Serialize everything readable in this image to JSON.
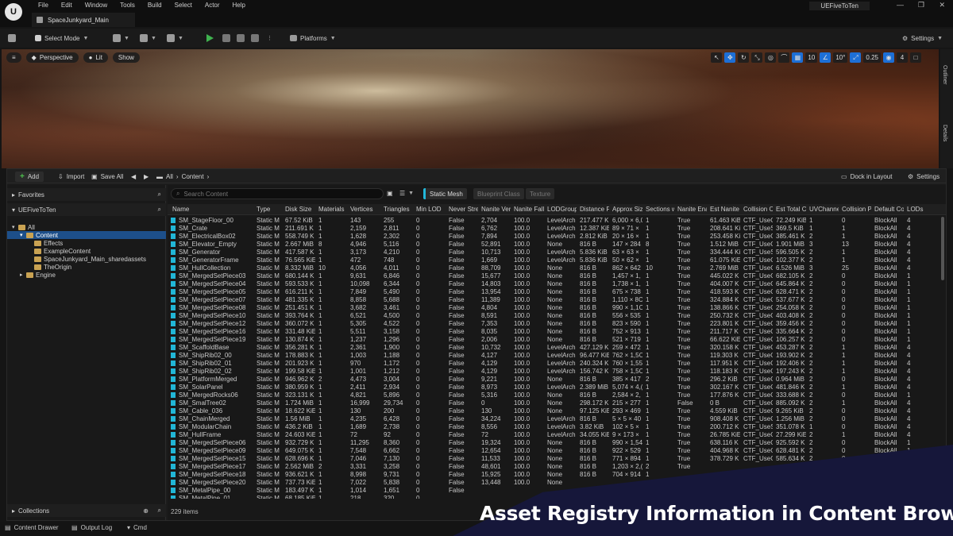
{
  "menu": [
    "File",
    "Edit",
    "Window",
    "Tools",
    "Build",
    "Select",
    "Actor",
    "Help"
  ],
  "project_name": "UEFiveToTen",
  "level_tab": "SpaceJunkyard_Main",
  "toolbar": {
    "select_mode": "Select Mode",
    "platforms": "Platforms",
    "settings": "Settings"
  },
  "viewport": {
    "perspective": "Perspective",
    "lit": "Lit",
    "show": "Show",
    "grid_snap": "10",
    "rot_snap": "10°",
    "scale_snap": "0.25",
    "camera_speed": "4",
    "side_tabs": [
      "Outliner",
      "Details"
    ]
  },
  "content_browser": {
    "add": "Add",
    "import": "Import",
    "save_all": "Save All",
    "path": [
      "All",
      "Content"
    ],
    "dock": "Dock in Layout",
    "settings": "Settings",
    "favorites": "Favorites",
    "project": "UEFiveToTen",
    "collections": "Collections",
    "tree": [
      {
        "label": "All",
        "level": 0
      },
      {
        "label": "Content",
        "level": 1,
        "selected": true
      },
      {
        "label": "Effects",
        "level": 2
      },
      {
        "label": "ExampleContent",
        "level": 2
      },
      {
        "label": "SpaceJunkyard_Main_sharedassets",
        "level": 2
      },
      {
        "label": "TheOrigin",
        "level": 2
      },
      {
        "label": "Engine",
        "level": 1
      }
    ],
    "search_placeholder": "Search Content",
    "filters": [
      {
        "label": "Static Mesh",
        "active": true
      },
      {
        "label": "Blueprint Class",
        "active": false
      },
      {
        "label": "Texture",
        "active": false
      }
    ],
    "columns": [
      "Name",
      "Type",
      "Disk Size",
      "Materials",
      "Vertices",
      "Triangles",
      "Min LOD",
      "Never Stre",
      "Nanite Ver",
      "Nanite Fall",
      "LODGroup",
      "Distance F",
      "Approx Siz",
      "Sections w",
      "Nanite Ena",
      "Est Nanite",
      "Collision Co",
      "Est Total C",
      "UVChanne",
      "Collision Pr",
      "Default Col",
      "LODs"
    ],
    "rows": [
      [
        "SM_StageFloor_00",
        "Static M",
        "67.52 KiB",
        "1",
        "143",
        "255",
        "0",
        "False",
        "2,704",
        "100.0",
        "LevelArch",
        "217.477 K",
        "6,000 × 6,0",
        "1",
        "True",
        "61.463 KiB",
        "CTF_UseC",
        "72.249 KiB",
        "1",
        "0",
        "BlockAll",
        "4"
      ],
      [
        "SM_Crate",
        "Static M",
        "211.691 K",
        "1",
        "2,159",
        "2,811",
        "0",
        "False",
        "6,762",
        "100.0",
        "LevelArch",
        "12.387 KiB",
        "89 × 71 ×",
        "1",
        "True",
        "208.641 Ki",
        "CTF_UseS",
        "369.5 KiB",
        "1",
        "1",
        "BlockAll",
        "4"
      ],
      [
        "SM_ElectricalBox02",
        "Static M",
        "558.749 K",
        "1",
        "1,628",
        "2,302",
        "0",
        "False",
        "7,894",
        "100.0",
        "LevelArch",
        "2.812 KiB",
        "20 × 16 ×",
        "1",
        "True",
        "253.458 Ki",
        "CTF_UseC",
        "385.461 K",
        "2",
        "1",
        "BlockAll",
        "4"
      ],
      [
        "SM_Elevator_Empty",
        "Static M",
        "2.667 MiB",
        "8",
        "4,946",
        "5,116",
        "0",
        "False",
        "52,891",
        "100.0",
        "None",
        "816 B",
        "147 × 284",
        "8",
        "True",
        "1.512 MiB",
        "CTF_UseC",
        "1.901 MiB",
        "3",
        "13",
        "BlockAll",
        "4"
      ],
      [
        "SM_Generator",
        "Static M",
        "417.587 K",
        "1",
        "3,173",
        "4,210",
        "0",
        "False",
        "10,713",
        "100.0",
        "LevelArch",
        "5.836 KiB",
        "63 × 63 ×",
        "1",
        "True",
        "334.444 Ki",
        "CTF_UseS",
        "596.505 K",
        "2",
        "1",
        "BlockAll",
        "4"
      ],
      [
        "SM_GeneratorFrame",
        "Static M",
        "76.565 KiE",
        "1",
        "472",
        "748",
        "0",
        "False",
        "1,669",
        "100.0",
        "LevelArch",
        "5.836 KiB",
        "50 × 62 ×",
        "1",
        "True",
        "61.075 KiE",
        "CTF_UseC",
        "102.377 K",
        "2",
        "1",
        "BlockAll",
        "4"
      ],
      [
        "SM_HullCollection",
        "Static M",
        "8.332 MiB",
        "10",
        "4,056",
        "4,011",
        "0",
        "False",
        "88,709",
        "100.0",
        "None",
        "816 B",
        "862 × 642",
        "10",
        "True",
        "2.769 MiB",
        "CTF_UseC",
        "6.526 MiB",
        "3",
        "25",
        "BlockAll",
        "4"
      ],
      [
        "SM_MergedSetPiece03",
        "Static M",
        "680.144 K",
        "1",
        "9,631",
        "6,846",
        "0",
        "False",
        "15,677",
        "100.0",
        "None",
        "816 B",
        "1,457 × 1,",
        "1",
        "True",
        "445.022 K",
        "CTF_UseC",
        "682.105 K",
        "2",
        "0",
        "BlockAll",
        "1"
      ],
      [
        "SM_MergedSetPiece04",
        "Static M",
        "593.533 K",
        "1",
        "10,098",
        "6,344",
        "0",
        "False",
        "14,803",
        "100.0",
        "None",
        "816 B",
        "1,738 × 1,",
        "1",
        "True",
        "404.007 K",
        "CTF_UseC",
        "645.864 K",
        "2",
        "0",
        "BlockAll",
        "1"
      ],
      [
        "SM_MergedSetPiece05",
        "Static M",
        "616.211 K",
        "1",
        "7,849",
        "5,490",
        "0",
        "False",
        "13,954",
        "100.0",
        "None",
        "816 B",
        "675 × 738",
        "1",
        "True",
        "418.593 K",
        "CTF_UseC",
        "628.471 K",
        "2",
        "0",
        "BlockAll",
        "1"
      ],
      [
        "SM_MergedSetPiece07",
        "Static M",
        "481.335 K",
        "1",
        "8,858",
        "5,688",
        "0",
        "False",
        "11,389",
        "100.0",
        "None",
        "816 B",
        "1,110 × 8C",
        "1",
        "True",
        "324.884 K",
        "CTF_UseC",
        "537.677 K",
        "2",
        "0",
        "BlockAll",
        "1"
      ],
      [
        "SM_MergedSetPiece08",
        "Static M",
        "251.451 K",
        "1",
        "3,682",
        "3,461",
        "0",
        "False",
        "4,804",
        "100.0",
        "None",
        "816 B",
        "990 × 1,1C",
        "1",
        "True",
        "138.866 K",
        "CTF_UseC",
        "254.058 K",
        "2",
        "0",
        "BlockAll",
        "1"
      ],
      [
        "SM_MergedSetPiece10",
        "Static M",
        "393.764 K",
        "1",
        "6,521",
        "4,500",
        "0",
        "False",
        "8,591",
        "100.0",
        "None",
        "816 B",
        "556 × 535",
        "1",
        "True",
        "250.732 K",
        "CTF_UseC",
        "403.408 K",
        "2",
        "0",
        "BlockAll",
        "1"
      ],
      [
        "SM_MergedSetPiece12",
        "Static M",
        "360.072 K",
        "1",
        "5,305",
        "4,522",
        "0",
        "False",
        "7,353",
        "100.0",
        "None",
        "816 B",
        "823 × 590",
        "1",
        "True",
        "223.801 K",
        "CTF_UseC",
        "359.456 K",
        "2",
        "0",
        "BlockAll",
        "1"
      ],
      [
        "SM_MergedSetPiece16",
        "Static M",
        "331.48 KiE",
        "1",
        "5,511",
        "3,158",
        "0",
        "False",
        "8,035",
        "100.0",
        "None",
        "816 B",
        "752 × 913",
        "1",
        "True",
        "211.717 K",
        "CTF_UseC",
        "335.664 K",
        "2",
        "0",
        "BlockAll",
        "1"
      ],
      [
        "SM_MergedSetPiece19",
        "Static M",
        "130.874 K",
        "1",
        "1,237",
        "1,296",
        "0",
        "False",
        "2,006",
        "100.0",
        "None",
        "816 B",
        "521 × 719",
        "1",
        "True",
        "66.622 KiE",
        "CTF_UseC",
        "106.257 K",
        "2",
        "0",
        "BlockAll",
        "1"
      ],
      [
        "SM_ScaffoldBase",
        "Static M",
        "356.281 K",
        "1",
        "2,361",
        "1,900",
        "0",
        "False",
        "10,732",
        "100.0",
        "LevelArch",
        "427.129 K",
        "259 × 472",
        "1",
        "True",
        "320.158 K",
        "CTF_UseC",
        "453.287 K",
        "2",
        "1",
        "BlockAll",
        "4"
      ],
      [
        "SM_ShipRib02_00",
        "Static M",
        "178.883 K",
        "1",
        "1,003",
        "1,188",
        "0",
        "False",
        "4,127",
        "100.0",
        "LevelArch",
        "96.477 KiE",
        "762 × 1,5C",
        "1",
        "True",
        "119.303 K",
        "CTF_UseC",
        "193.902 K",
        "2",
        "1",
        "BlockAll",
        "4"
      ],
      [
        "SM_ShipRib02_01",
        "Static M",
        "201.923 K",
        "1",
        "970",
        "1,172",
        "0",
        "False",
        "4,129",
        "100.0",
        "LevelArch",
        "240.324 K",
        "760 × 1,55",
        "1",
        "True",
        "117.951 K",
        "CTF_UseC",
        "192.406 K",
        "2",
        "1",
        "BlockAll",
        "4"
      ],
      [
        "SM_ShipRib02_02",
        "Static M",
        "199.58 KiE",
        "1",
        "1,001",
        "1,212",
        "0",
        "False",
        "4,129",
        "100.0",
        "LevelArch",
        "156.742 K",
        "758 × 1,5C",
        "1",
        "True",
        "118.183 K",
        "CTF_UseC",
        "197.243 K",
        "2",
        "1",
        "BlockAll",
        "4"
      ],
      [
        "SM_PlatformMerged",
        "Static M",
        "946.962 K",
        "2",
        "4,473",
        "3,004",
        "0",
        "False",
        "9,221",
        "100.0",
        "None",
        "816 B",
        "385 × 417",
        "2",
        "True",
        "296.2 KiB",
        "CTF_UseC",
        "0.964 MiB",
        "2",
        "0",
        "BlockAll",
        "4"
      ],
      [
        "SM_SolarPanel",
        "Static M",
        "380.959 K",
        "1",
        "2,411",
        "2,934",
        "0",
        "False",
        "8,973",
        "100.0",
        "LevelArch",
        "2.389 MiB",
        "5,074 × 4,(",
        "1",
        "True",
        "302.167 K",
        "CTF_UseC",
        "481.846 K",
        "2",
        "1",
        "BlockAll",
        "4"
      ],
      [
        "SM_MergedRocks06",
        "Static M",
        "323.131 K",
        "1",
        "4,821",
        "5,896",
        "0",
        "False",
        "5,316",
        "100.0",
        "None",
        "816 B",
        "2,584 × 2,",
        "1",
        "True",
        "177.876 K",
        "CTF_UseC",
        "333.688 K",
        "2",
        "0",
        "BlockAll",
        "1"
      ],
      [
        "SM_SmalTree02",
        "Static M",
        "1.724 MiB",
        "1",
        "16,999",
        "29,734",
        "0",
        "False",
        "0",
        "100.0",
        "None",
        "298.172 K",
        "215 × 277",
        "1",
        "False",
        "0 B",
        "CTF_UseC",
        "885.092 K",
        "2",
        "1",
        "BlockAll",
        "4"
      ],
      [
        "SM_Cable_036",
        "Static M",
        "18.622 KiE",
        "1",
        "130",
        "200",
        "0",
        "False",
        "130",
        "100.0",
        "None",
        "97.125 KiE",
        "293 × 469",
        "1",
        "True",
        "4.559 KiB",
        "CTF_UseC",
        "9.265 KiB",
        "2",
        "0",
        "BlockAll",
        "4"
      ],
      [
        "SM_ChainMerged",
        "Static M",
        "1.56 MiB",
        "1",
        "4,235",
        "6,428",
        "0",
        "False",
        "34,224",
        "100.0",
        "LevelArch",
        "816 B",
        "5 × 5 × 40",
        "1",
        "True",
        "908.408 K",
        "CTF_UseC",
        "1.256 MiB",
        "2",
        "0",
        "BlockAll",
        "4"
      ],
      [
        "SM_ModularChain",
        "Static M",
        "436.2 KiB",
        "1",
        "1,689",
        "2,738",
        "0",
        "False",
        "8,556",
        "100.0",
        "LevelArch",
        "3.82 KiB",
        "102 × 5 ×",
        "1",
        "True",
        "200.712 K",
        "CTF_UseS",
        "351.078 K",
        "1",
        "0",
        "BlockAll",
        "4"
      ],
      [
        "SM_HullFrame",
        "Static M",
        "24.603 KiE",
        "1",
        "72",
        "92",
        "0",
        "False",
        "72",
        "100.0",
        "LevelArch",
        "34.055 KiE",
        "9 × 173 ×",
        "1",
        "True",
        "26.785 KiE",
        "CTF_UseC",
        "27.299 KiE",
        "2",
        "1",
        "BlockAll",
        "4"
      ],
      [
        "SM_MergedSetPiece06",
        "Static M",
        "932.729 K",
        "1",
        "11,295",
        "8,360",
        "0",
        "False",
        "19,324",
        "100.0",
        "None",
        "816 B",
        "990 × 1,54",
        "1",
        "True",
        "638.116 K",
        "CTF_UseC",
        "925.592 K",
        "2",
        "0",
        "BlockAll",
        "1"
      ],
      [
        "SM_MergedSetPiece09",
        "Static M",
        "649.075 K",
        "1",
        "7,548",
        "6,662",
        "0",
        "False",
        "12,654",
        "100.0",
        "None",
        "816 B",
        "922 × 529",
        "1",
        "True",
        "404.968 K",
        "CTF_UseC",
        "628.481 K",
        "2",
        "0",
        "BlockAll",
        "1"
      ],
      [
        "SM_MergedSetPiece15",
        "Static M",
        "628.696 K",
        "1",
        "7,046",
        "7,130",
        "0",
        "False",
        "11,533",
        "100.0",
        "None",
        "816 B",
        "771 × 894",
        "1",
        "True",
        "378.729 K",
        "CTF_UseC",
        "585.634 K",
        "2",
        "0",
        "BlockAll",
        "1"
      ],
      [
        "SM_MergedSetPiece17",
        "Static M",
        "2.562 MiB",
        "2",
        "3,331",
        "3,258",
        "0",
        "False",
        "48,601",
        "100.0",
        "None",
        "816 B",
        "1,203 × 2,(",
        "2",
        "True",
        "",
        "",
        "",
        "",
        "",
        "BlockAll",
        "1"
      ],
      [
        "SM_MergedSetPiece18",
        "Static M",
        "936.621 K",
        "1",
        "8,998",
        "9,731",
        "0",
        "False",
        "15,925",
        "100.0",
        "None",
        "816 B",
        "704 × 914",
        "1",
        "",
        "",
        "",
        "",
        "",
        "",
        "",
        ""
      ],
      [
        "SM_MergedSetPiece20",
        "Static M",
        "737.73 KiE",
        "1",
        "7,022",
        "5,838",
        "0",
        "False",
        "13,448",
        "100.0",
        "None",
        "",
        "",
        "",
        "",
        "",
        "",
        "",
        "",
        "",
        "",
        ""
      ],
      [
        "SM_MetalPipe_00",
        "Static M",
        "183.497 K",
        "1",
        "1,014",
        "1,651",
        "0",
        "False",
        "",
        "",
        "",
        "",
        "",
        "",
        "",
        "",
        "",
        "",
        "",
        "",
        "",
        ""
      ],
      [
        "SM_MetalPipe_01",
        "Static M",
        "68.185 KiE",
        "1",
        "218",
        "320",
        "0",
        "",
        "",
        "",
        "",
        "",
        "",
        "",
        "",
        "",
        "",
        "",
        "",
        "",
        "",
        ""
      ]
    ],
    "item_count": "229 items"
  },
  "statusbar": {
    "content_drawer": "Content Drawer",
    "output_log": "Output Log",
    "cmd": "Cmd"
  },
  "banner": "Asset Registry Information in Content Browser"
}
